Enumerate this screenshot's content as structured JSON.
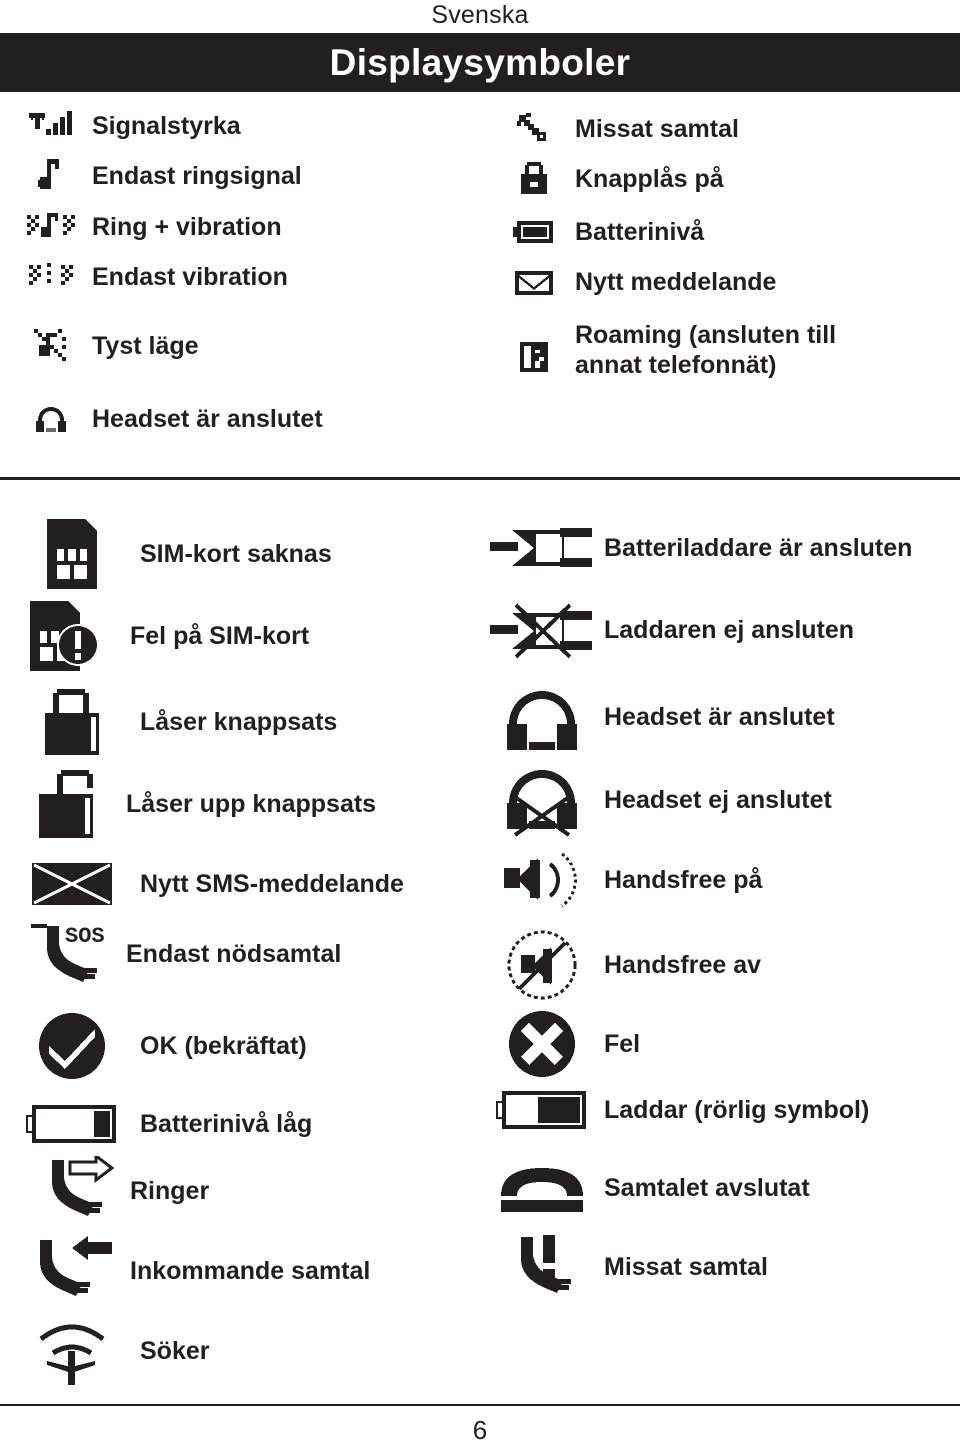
{
  "header": {
    "language": "Svenska",
    "title": "Displaysymboler"
  },
  "top_section": {
    "left_column": [
      {
        "icon": "signal-strength-icon",
        "label": "Signalstyrka"
      },
      {
        "icon": "ring-only-icon",
        "label": "Endast ringsignal"
      },
      {
        "icon": "ring-and-vibrate-icon",
        "label": "Ring + vibration"
      },
      {
        "icon": "vibrate-only-icon",
        "label": "Endast vibration"
      },
      {
        "icon": "silent-mode-icon",
        "label": "Tyst läge"
      },
      {
        "icon": "headset-connected-small-icon",
        "label": "Headset är anslutet"
      }
    ],
    "right_column": [
      {
        "icon": "missed-call-small-icon",
        "label": "Missat samtal"
      },
      {
        "icon": "keypad-lock-icon",
        "label": "Knapplås på"
      },
      {
        "icon": "battery-level-icon",
        "label": "Batterinivå"
      },
      {
        "icon": "new-message-icon",
        "label": "Nytt meddelande"
      },
      {
        "icon": "roaming-icon",
        "label": "Roaming (ansluten till\nannat telefonnät)"
      }
    ]
  },
  "bottom_section": {
    "left_column": [
      {
        "icon": "sim-card-missing-icon",
        "label": "SIM-kort saknas"
      },
      {
        "icon": "sim-card-error-icon",
        "label": "Fel på SIM-kort"
      },
      {
        "icon": "lock-closed-icon",
        "label": "Låser knappsats"
      },
      {
        "icon": "lock-open-icon",
        "label": "Låser upp knappsats"
      },
      {
        "icon": "new-sms-icon",
        "label": "Nytt SMS-meddelande"
      },
      {
        "icon": "emergency-calls-only-icon",
        "label": "Endast nödsamtal"
      },
      {
        "icon": "ok-check-icon",
        "label": "OK (bekräftat)"
      },
      {
        "icon": "battery-low-icon",
        "label": "Batterinivå låg"
      },
      {
        "icon": "outgoing-call-icon",
        "label": "Ringer"
      },
      {
        "icon": "incoming-call-icon",
        "label": "Inkommande samtal"
      },
      {
        "icon": "searching-icon",
        "label": "Söker"
      }
    ],
    "right_column": [
      {
        "icon": "charger-connected-icon",
        "label": "Batteriladdare är ansluten"
      },
      {
        "icon": "charger-disconnected-icon",
        "label": "Laddaren ej ansluten"
      },
      {
        "icon": "headset-connected-icon",
        "label": "Headset är anslutet"
      },
      {
        "icon": "headset-disconnected-icon",
        "label": "Headset ej anslutet"
      },
      {
        "icon": "handsfree-on-icon",
        "label": "Handsfree på"
      },
      {
        "icon": "handsfree-off-icon",
        "label": "Handsfree av"
      },
      {
        "icon": "error-cross-icon",
        "label": "Fel"
      },
      {
        "icon": "battery-charging-icon",
        "label": "Laddar (rörlig symbol)"
      },
      {
        "icon": "call-ended-icon",
        "label": "Samtalet avslutat"
      },
      {
        "icon": "missed-call-icon",
        "label": "Missat samtal"
      }
    ]
  },
  "footer": {
    "page_number": "6"
  },
  "colors": {
    "ink": "#231f20",
    "paper": "#ffffff"
  }
}
